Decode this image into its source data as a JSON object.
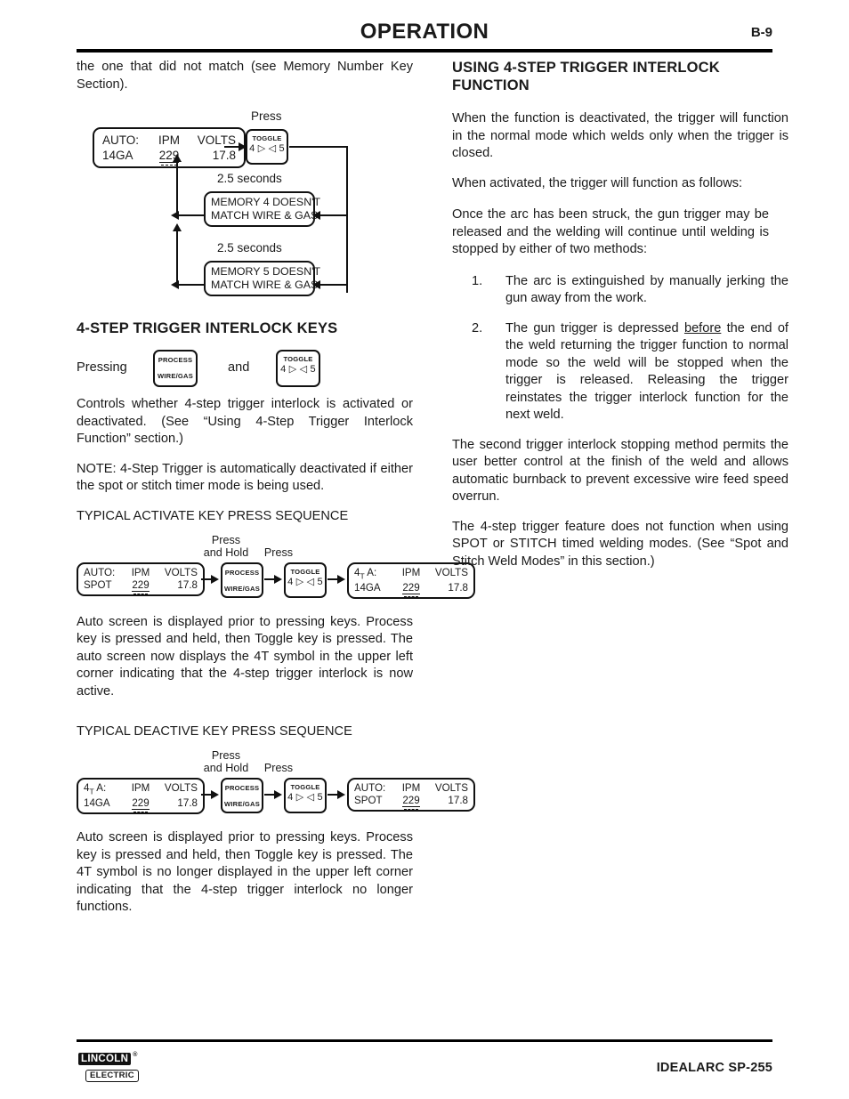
{
  "header": {
    "title": "OPERATION",
    "page_number": "B-9"
  },
  "left_column": {
    "intro_paragraph": "the one that did not match (see Memory Number Key Section).",
    "diagram1": {
      "press_label": "Press",
      "auto_display": {
        "line1": [
          "AUTO:",
          "IPM",
          "VOLTS"
        ],
        "line2": [
          "14GA",
          "229",
          "17.8"
        ]
      },
      "toggle_key": {
        "top": "TOGGLE",
        "bottom": "4 ▷  ◁ 5"
      },
      "timer1_label": "2.5 seconds",
      "message1": {
        "line1": "MEMORY 4 DOESN'T",
        "line2": "MATCH WIRE & GAS"
      },
      "timer2_label": "2.5 seconds",
      "message2": {
        "line1": "MEMORY 5 DOESN'T",
        "line2": "MATCH WIRE & GAS"
      }
    },
    "section_heading": "4-STEP TRIGGER INTERLOCK KEYS",
    "pressing_prefix": "Pressing",
    "pressing_conjunction": "and",
    "process_key": {
      "top": "PROCESS",
      "bottom": "WIRE/GAS"
    },
    "toggle_key": {
      "top": "TOGGLE",
      "bottom": "4 ▷  ◁ 5"
    },
    "controls_paragraph": "Controls whether 4-step trigger interlock is activated or deactivated. (See “Using 4-Step Trigger Interlock Function” section.)",
    "note_paragraph": "NOTE: 4-Step Trigger is automatically deactivated if either the spot or stitch timer mode is being used.",
    "activate_subhead": "TYPICAL ACTIVATE KEY PRESS SEQUENCE",
    "activate_diagram": {
      "press_and_hold_label_line1": "Press",
      "press_and_hold_label_line2": "and Hold",
      "press_label": "Press",
      "display_before": {
        "line1": [
          "AUTO:",
          "IPM",
          "VOLTS"
        ],
        "line2": [
          "SPOT",
          "229",
          "17.8"
        ]
      },
      "process_key": {
        "top": "PROCESS",
        "bottom": "WIRE/GAS"
      },
      "toggle_key": {
        "top": "TOGGLE",
        "bottom": "4 ▷  ◁ 5"
      },
      "display_after": {
        "line1": [
          "4",
          "T",
          " A:",
          "IPM",
          "VOLTS"
        ],
        "line2": [
          "14GA",
          "229",
          "17.8"
        ]
      }
    },
    "activate_paragraph": "Auto screen is displayed prior to pressing keys. Process key is pressed and held, then Toggle key is pressed. The auto screen now displays the 4T symbol in the upper left corner indicating that the 4-step trigger interlock is now active.",
    "deactive_subhead": "TYPICAL DEACTIVE KEY PRESS SEQUENCE",
    "deactive_diagram": {
      "press_and_hold_label_line1": "Press",
      "press_and_hold_label_line2": "and Hold",
      "press_label": "Press",
      "display_before": {
        "line1": [
          "4",
          "T",
          " A:",
          "IPM",
          "VOLTS"
        ],
        "line2": [
          "14GA",
          "229",
          "17.8"
        ]
      },
      "process_key": {
        "top": "PROCESS",
        "bottom": "WIRE/GAS"
      },
      "toggle_key": {
        "top": "TOGGLE",
        "bottom": "4 ▷  ◁ 5"
      },
      "display_after": {
        "line1": [
          "AUTO:",
          "IPM",
          "VOLTS"
        ],
        "line2": [
          "SPOT",
          "229",
          "17.8"
        ]
      }
    },
    "deactive_paragraph": "Auto screen is displayed prior to pressing keys. Process key is pressed and held, then Toggle key is pressed. The 4T symbol is no longer displayed in the upper left corner indicating that the 4-step trigger interlock no longer functions."
  },
  "right_column": {
    "heading_line1": "USING 4-STEP TRIGGER INTERLOCK",
    "heading_line2": "FUNCTION",
    "para1": "When the function is deactivated, the trigger will function in the normal mode which welds only when the trigger is closed.",
    "para2": "When activated, the trigger will function as follows:",
    "para3_indented": "Once the arc has been struck, the gun trigger may be released and the welding will continue until welding is stopped by either of two methods:",
    "list": [
      {
        "number": "1.",
        "text_before": "The arc is extinguished by manually jerking the gun away from the work.",
        "underlined": "",
        "text_after": ""
      },
      {
        "number": "2.",
        "text_before": "The gun trigger is depressed ",
        "underlined": "before",
        "text_after": " the end of the weld returning the trigger function to normal mode so the weld will be stopped when the trigger is released. Releasing the trigger reinstates the trigger interlock function for the next weld."
      }
    ],
    "para4": "The second trigger interlock stopping method permits the user better control at the finish of the weld and allows automatic burnback to prevent excessive wire feed speed overrun.",
    "para5": "The 4-step trigger feature does not function when using SPOT or STITCH timed welding modes. (See “Spot and Stitch Weld Modes” in this section.)"
  },
  "footer": {
    "logo_line1": "LINCOLN",
    "logo_reg": "®",
    "logo_line2": "ELECTRIC",
    "model": "IDEALARC SP-255"
  }
}
